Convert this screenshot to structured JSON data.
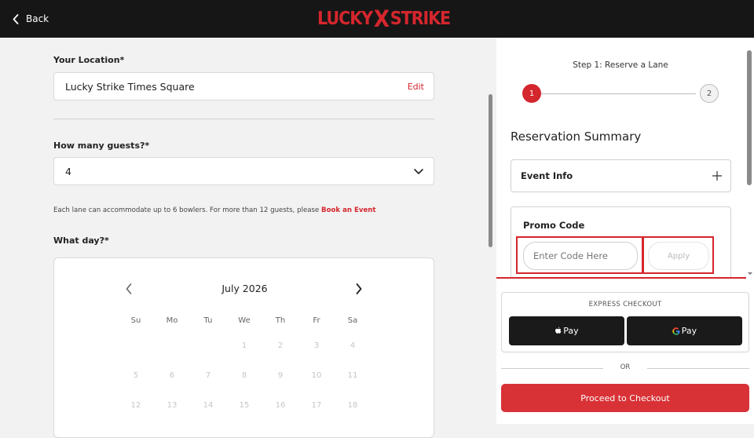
{
  "header": {
    "back_label": "Back",
    "logo_left": "LUCKY",
    "logo_mid": "X",
    "logo_right": "STRIKE"
  },
  "form": {
    "location_label": "Your Location*",
    "location_value": "Lucky Strike Times Square",
    "edit_label": "Edit",
    "guests_label": "How many guests?*",
    "guests_value": "4",
    "note_text": "Each lane can accommodate up to 6 bowlers. For more than 12 guests, please ",
    "note_link": "Book an Event",
    "day_label": "What day?*"
  },
  "calendar": {
    "month": "July 2026",
    "weekdays": [
      "Su",
      "Mo",
      "Tu",
      "We",
      "Th",
      "Fr",
      "Sa"
    ],
    "weeks": [
      [
        "",
        "",
        "",
        "1",
        "2",
        "3",
        "4"
      ],
      [
        "5",
        "6",
        "7",
        "8",
        "9",
        "10",
        "11"
      ],
      [
        "12",
        "13",
        "14",
        "15",
        "16",
        "17",
        "18"
      ]
    ]
  },
  "summary": {
    "step_label": "Step 1: Reserve a Lane",
    "step1": "1",
    "step2": "2",
    "title": "Reservation Summary",
    "event_info": "Event Info",
    "promo_title": "Promo Code",
    "promo_placeholder": "Enter Code Here",
    "apply_label": "Apply"
  },
  "checkout": {
    "express_label": "EXPRESS CHECKOUT",
    "apple_pay": "Pay",
    "google_pay": "Pay",
    "or_label": "OR",
    "proceed_label": "Proceed to Checkout"
  },
  "colors": {
    "accent": "#d4262d",
    "header_bg": "#161616"
  }
}
